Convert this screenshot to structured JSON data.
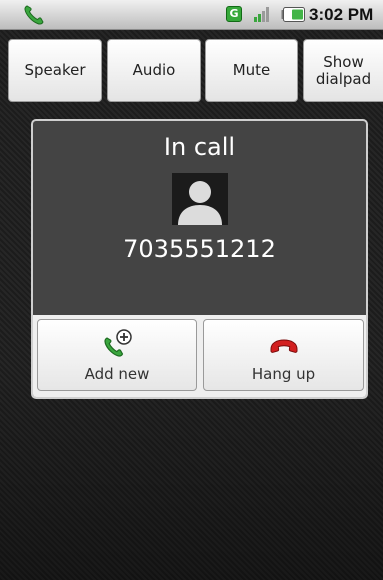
{
  "status_bar": {
    "network_type": "G",
    "time": "3:02 PM"
  },
  "call_controls": {
    "speaker": "Speaker",
    "audio": "Audio",
    "mute": "Mute",
    "show_dialpad_line1": "Show",
    "show_dialpad_line2": "dialpad"
  },
  "call": {
    "state": "In call",
    "number": "7035551212"
  },
  "actions": {
    "add_new": "Add new",
    "hang_up": "Hang up"
  },
  "colors": {
    "accept_green": "#3aa63e",
    "hangup_red": "#d21f1f"
  }
}
